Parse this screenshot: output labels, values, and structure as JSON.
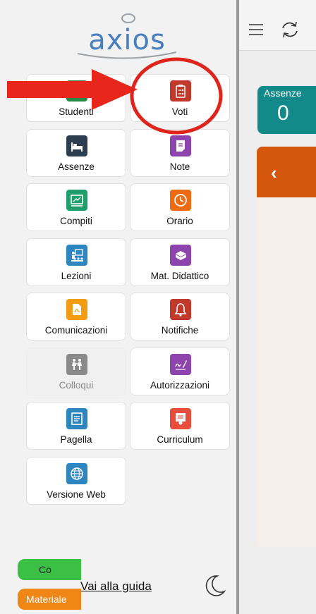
{
  "brand": {
    "logo_text": "axios",
    "logo_color": "#4a7fbf"
  },
  "menu": [
    {
      "label": "Studenti",
      "icon": "students-icon",
      "color": "#2a8a4a",
      "enabled": true
    },
    {
      "label": "Voti",
      "icon": "grades-clipboard-icon",
      "color": "#c0392b",
      "enabled": true
    },
    {
      "label": "Assenze",
      "icon": "bed-icon",
      "color": "#2c3e50",
      "enabled": true
    },
    {
      "label": "Note",
      "icon": "note-icon",
      "color": "#8e44ad",
      "enabled": true
    },
    {
      "label": "Compiti",
      "icon": "chalkboard-icon",
      "color": "#1e9e6a",
      "enabled": true
    },
    {
      "label": "Orario",
      "icon": "clock-icon",
      "color": "#f06a12",
      "enabled": true
    },
    {
      "label": "Lezioni",
      "icon": "classroom-icon",
      "color": "#2e86c1",
      "enabled": true
    },
    {
      "label": "Mat. Didattico",
      "icon": "books-icon",
      "color": "#8e44ad",
      "enabled": true
    },
    {
      "label": "Comunicazioni",
      "icon": "pdf-icon",
      "color": "#f39c12",
      "enabled": true
    },
    {
      "label": "Notifiche",
      "icon": "bell-icon",
      "color": "#c0392b",
      "enabled": true
    },
    {
      "label": "Colloqui",
      "icon": "meeting-icon",
      "color": "#8a8a8a",
      "enabled": false
    },
    {
      "label": "Autorizzazioni",
      "icon": "signature-icon",
      "color": "#8e44ad",
      "enabled": true
    },
    {
      "label": "Pagella",
      "icon": "report-card-icon",
      "color": "#2e86c1",
      "enabled": true
    },
    {
      "label": "Curriculum",
      "icon": "certificate-icon",
      "color": "#e74c3c",
      "enabled": true
    },
    {
      "label": "Versione Web",
      "icon": "globe-icon",
      "color": "#2e86c1",
      "enabled": true
    }
  ],
  "footer": {
    "guide_link": "Vai alla guida"
  },
  "main": {
    "absences": {
      "title": "Assenze",
      "value": "0",
      "color": "#138a8a"
    },
    "panel_color": "#d4570d",
    "pills": [
      {
        "label": "Co",
        "color": "#3bbf45"
      },
      {
        "label": "Materiale",
        "color": "#ef8615"
      }
    ]
  },
  "annotation": {
    "arrow_color": "#e8261c",
    "ring_color": "#e0241b"
  }
}
